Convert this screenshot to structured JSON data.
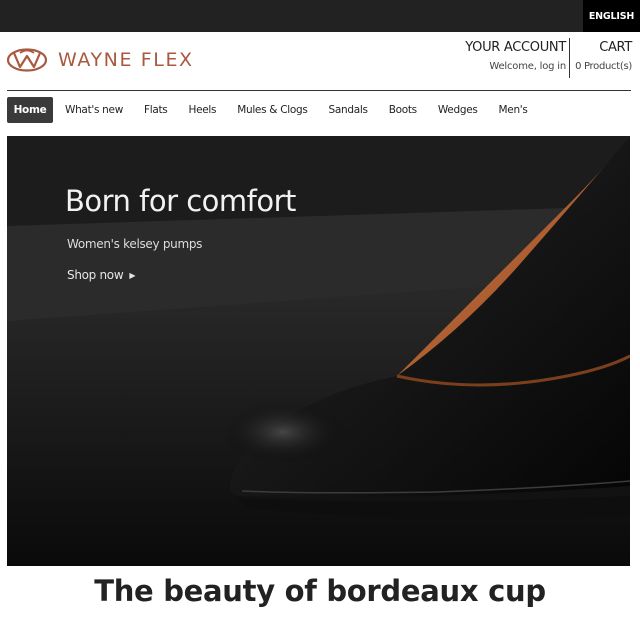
{
  "topbar": {
    "language": "ENGLISH"
  },
  "brand": {
    "name": "WAYNE FLEX",
    "color": "#a8593f"
  },
  "account": {
    "title": "YOUR ACCOUNT",
    "subtitle": "Welcome, log in"
  },
  "cart": {
    "title": "CART",
    "subtitle": "0 Product(s)"
  },
  "nav": {
    "items": [
      {
        "label": "Home",
        "active": true
      },
      {
        "label": "What's new"
      },
      {
        "label": "Flats"
      },
      {
        "label": "Heels"
      },
      {
        "label": "Mules & Clogs"
      },
      {
        "label": "Sandals"
      },
      {
        "label": "Boots"
      },
      {
        "label": "Wedges"
      },
      {
        "label": "Men's"
      }
    ]
  },
  "hero": {
    "title": "Born for comfort",
    "subtitle": "Women's kelsey pumps",
    "cta": "Shop now",
    "cta_icon": "play-arrow-icon"
  },
  "headline": "The beauty of bordeaux cup"
}
